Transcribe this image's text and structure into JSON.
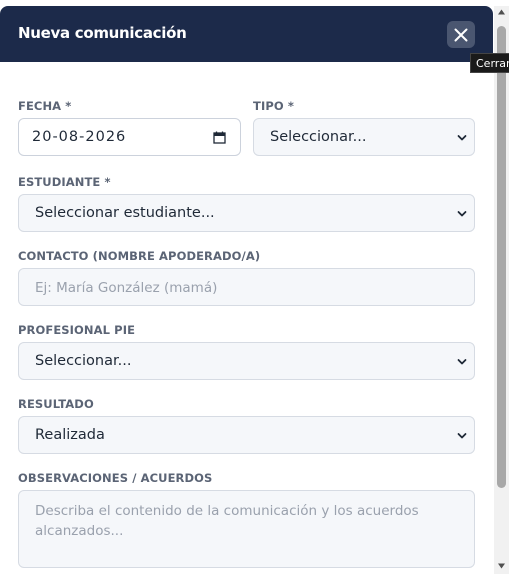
{
  "modal": {
    "title": "Nueva comunicación",
    "close_tooltip": "Cerrar"
  },
  "form": {
    "fecha": {
      "label": "FECHA *",
      "value": "20-08-2026"
    },
    "tipo": {
      "label": "TIPO *",
      "value": "Seleccionar..."
    },
    "estudiante": {
      "label": "ESTUDIANTE *",
      "value": "Seleccionar estudiante..."
    },
    "contacto": {
      "label": "CONTACTO (NOMBRE APODERADO/A)",
      "placeholder": "Ej: María González (mamá)"
    },
    "profesional": {
      "label": "PROFESIONAL PIE",
      "value": "Seleccionar..."
    },
    "resultado": {
      "label": "RESULTADO",
      "value": "Realizada"
    },
    "observaciones": {
      "label": "OBSERVACIONES / ACUERDOS",
      "placeholder": "Describa el contenido de la comunicación y los acuerdos alcanzados..."
    }
  },
  "icons": {
    "close": "close-icon",
    "calendar": "calendar-icon",
    "chevron": "chevron-down-icon"
  },
  "colors": {
    "header_bg": "#1c2a4a",
    "close_bg": "#4a5670",
    "label": "#5b6475",
    "field_bg": "#f5f7fa"
  }
}
